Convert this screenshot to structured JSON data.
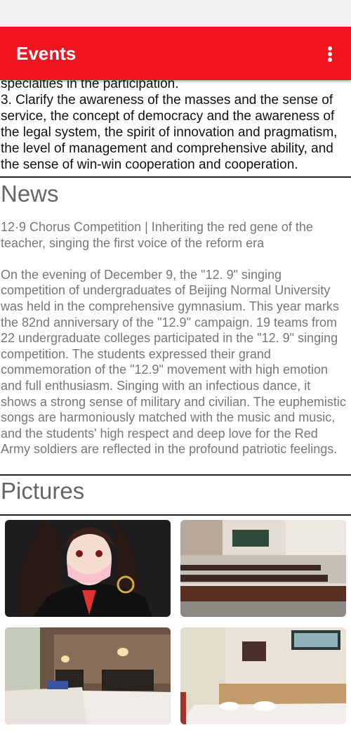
{
  "app_bar": {
    "title": "Events",
    "menu_icon": "more-vert-icon"
  },
  "goals": {
    "partial_line": "specialties in the participation.",
    "item3": "3. Clarify the awareness of the masses and the sense of service, the concept of democracy and the awareness of the legal system, the spirit of innovation and pragmatism, the level of management and comprehensive ability, and the sense of win-win cooperation and cooperation."
  },
  "news": {
    "heading": "News",
    "headline": "12·9 Chorus Competition | Inheriting the red gene of the teacher, singing the first voice of the reform era",
    "body": "On the evening of December 9, the \"12. 9\" singing competition of undergraduates of Beijing Normal University was held in the comprehensive gymnasium. This year marks the 82nd anniversary of the \"12.9\" campaign. 19 teams from 22 undergraduate colleges participated in the \"12. 9\" singing competition. The students expressed their grand commemoration of the \"12.9\" movement with high emotion and full enthusiasm. Singing with an infectious dance, it shows a strong sense of military and civilian. The euphemistic songs are harmoniously matched with the music and music, and the students' high respect and deep love for the Red Army soldiers are reflected in the profound patriotic feelings."
  },
  "pictures": {
    "heading": "Pictures",
    "items": [
      {
        "subject": "anime character wearing mask"
      },
      {
        "subject": "classroom with rows of desks"
      },
      {
        "subject": "hotel room with two beds"
      },
      {
        "subject": "hotel room with bed and artwork"
      }
    ]
  },
  "colors": {
    "app_bar": "#f0141f",
    "title_text": "#ffffff"
  }
}
